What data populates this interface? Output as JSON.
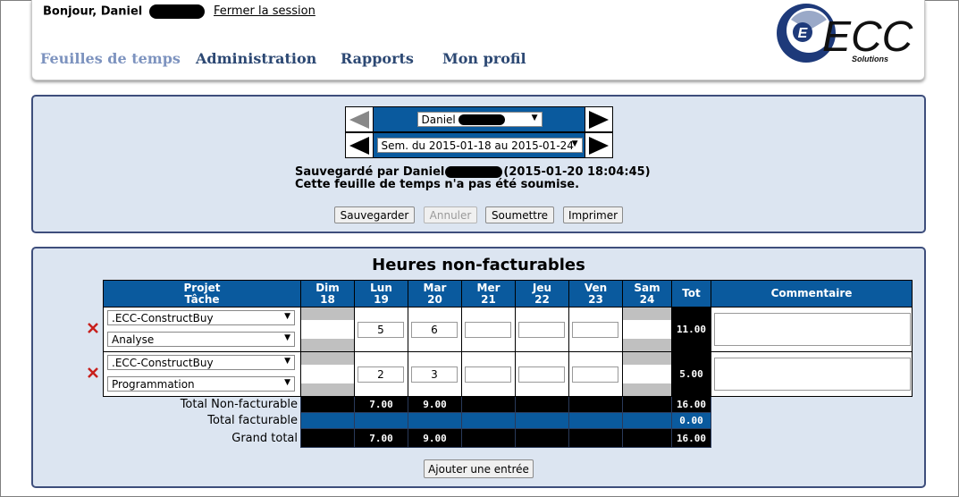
{
  "header": {
    "greeting": "Bonjour, Daniel",
    "logout": "Fermer la session",
    "nav": [
      "Feuilles de temps",
      "Administration",
      "Rapports",
      "Mon profil"
    ],
    "logo_text": "ECC",
    "logo_sub": "Solutions"
  },
  "selector": {
    "user": "Daniel",
    "week": "Sem. du 2015-01-18 au 2015-01-24"
  },
  "status": {
    "saved_by": "Sauvegardé par Daniel",
    "saved_time": "(2015-01-20 18:04:45)",
    "submitted": "Cette feuille de temps n'a pas été soumise."
  },
  "actions": {
    "save": "Sauvegarder",
    "cancel": "Annuler",
    "submit": "Soumettre",
    "print": "Imprimer"
  },
  "section_title": "Heures non-facturables",
  "columns": {
    "project": "Projet",
    "task": "Tâche",
    "days": [
      {
        "name": "Dim",
        "num": "18"
      },
      {
        "name": "Lun",
        "num": "19"
      },
      {
        "name": "Mar",
        "num": "20"
      },
      {
        "name": "Mer",
        "num": "21"
      },
      {
        "name": "Jeu",
        "num": "22"
      },
      {
        "name": "Ven",
        "num": "23"
      },
      {
        "name": "Sam",
        "num": "24"
      }
    ],
    "total": "Tot",
    "comment": "Commentaire"
  },
  "rows": [
    {
      "project": ".ECC-ConstructBuy",
      "task": "Analyse",
      "hours": [
        "",
        "5",
        "6",
        "",
        "",
        "",
        ""
      ],
      "total": "11.00"
    },
    {
      "project": ".ECC-ConstructBuy",
      "task": "Programmation",
      "hours": [
        "",
        "2",
        "3",
        "",
        "",
        "",
        ""
      ],
      "total": "5.00"
    }
  ],
  "summary": {
    "nonbill_label": "Total Non-facturable",
    "nonbill": [
      "",
      "7.00",
      "9.00",
      "",
      "",
      "",
      ""
    ],
    "nonbill_total": "16.00",
    "bill_label": "Total facturable",
    "bill_total": "0.00",
    "grand_label": "Grand total",
    "grand": [
      "",
      "7.00",
      "9.00",
      "",
      "",
      "",
      ""
    ],
    "grand_total": "16.00"
  },
  "add_entry": "Ajouter une entrée",
  "colors": {
    "header_blue": "#0a5a9e",
    "panel_bg": "#dce5f1",
    "nav": "#2c4873",
    "nav_active": "#7d93bf"
  }
}
